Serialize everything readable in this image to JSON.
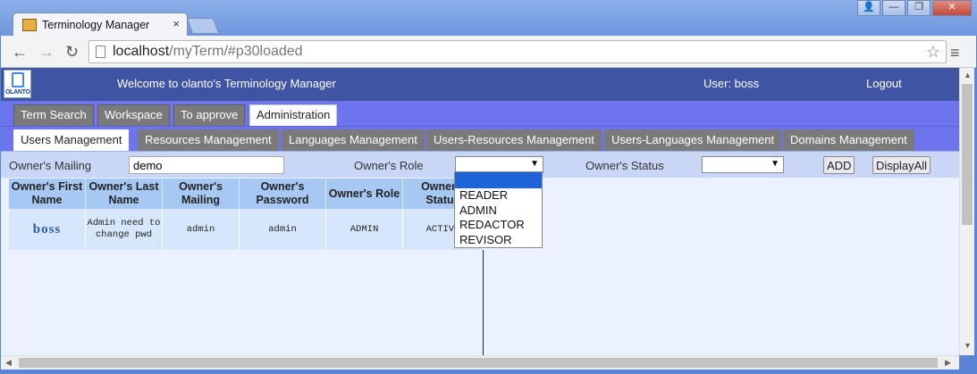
{
  "browser": {
    "tab_title": "Terminology Manager",
    "tab_close": "×",
    "url_host": "localhost",
    "url_path": "/myTerm/#p30loaded",
    "win_user": "👤",
    "win_min": "—",
    "win_max": "❐",
    "win_close": "✕",
    "back": "←",
    "forward": "→",
    "reload": "↻",
    "star": "☆",
    "menu": "≡"
  },
  "app": {
    "logo_text": "OLANTO",
    "welcome": "Welcome to olanto's Terminology Manager",
    "user": "User: boss",
    "logout": "Logout"
  },
  "main_tabs": [
    {
      "label": "Term Search"
    },
    {
      "label": "Workspace"
    },
    {
      "label": "To approve"
    },
    {
      "label": "Administration"
    }
  ],
  "sub_tabs": [
    {
      "label": "Users Management"
    },
    {
      "label": "Resources Management"
    },
    {
      "label": "Languages Management"
    },
    {
      "label": "Users-Resources Management"
    },
    {
      "label": "Users-Languages Management"
    },
    {
      "label": "Domains Management"
    }
  ],
  "filter": {
    "mailing_label": "Owner's Mailing",
    "mailing_value": "demo",
    "role_label": "Owner's Role",
    "role_value": "",
    "status_label": "Owner's Status",
    "status_value": "",
    "add_label": "ADD",
    "display_all_label": "DisplayAll",
    "role_options": [
      "",
      "READER",
      "ADMIN",
      "REDACTOR",
      "REVISOR"
    ]
  },
  "table": {
    "headers": [
      "Owner's First Name",
      "Owner's Last Name",
      "Owner's Mailing",
      "Owner's Password",
      "Owner's Role",
      "Owner's Status"
    ],
    "rows": [
      [
        "boss",
        "Admin need to change pwd",
        "admin",
        "admin",
        "ADMIN",
        "ACTIVE"
      ]
    ]
  }
}
